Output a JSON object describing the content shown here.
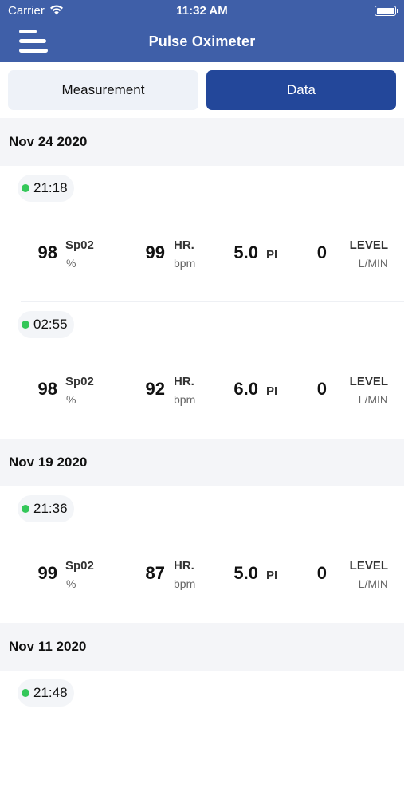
{
  "status_bar": {
    "carrier": "Carrier",
    "time": "11:32 AM"
  },
  "nav": {
    "title": "Pulse Oximeter"
  },
  "tabs": [
    {
      "label": "Measurement",
      "active": false
    },
    {
      "label": "Data",
      "active": true
    }
  ],
  "colors": {
    "header_bg": "#3f5fa8",
    "active_tab": "#23479a",
    "status_dot": "#34c759"
  },
  "groups": [
    {
      "date": "Nov 24 2020",
      "records": [
        {
          "time": "21:18",
          "spo2": "98",
          "spo2_label": "Sp02",
          "spo2_unit": "%",
          "hr": "99",
          "hr_label": "HR.",
          "hr_unit": "bpm",
          "pi": "5.0",
          "pi_label": "PI",
          "level": "0",
          "level_label": "LEVEL",
          "level_unit": "L/MIN"
        },
        {
          "time": "02:55",
          "spo2": "98",
          "spo2_label": "Sp02",
          "spo2_unit": "%",
          "hr": "92",
          "hr_label": "HR.",
          "hr_unit": "bpm",
          "pi": "6.0",
          "pi_label": "PI",
          "level": "0",
          "level_label": "LEVEL",
          "level_unit": "L/MIN"
        }
      ]
    },
    {
      "date": "Nov 19 2020",
      "records": [
        {
          "time": "21:36",
          "spo2": "99",
          "spo2_label": "Sp02",
          "spo2_unit": "%",
          "hr": "87",
          "hr_label": "HR.",
          "hr_unit": "bpm",
          "pi": "5.0",
          "pi_label": "PI",
          "level": "0",
          "level_label": "LEVEL",
          "level_unit": "L/MIN"
        }
      ]
    },
    {
      "date": "Nov 11 2020",
      "records": [
        {
          "time": "21:48",
          "spo2": "",
          "spo2_label": "",
          "spo2_unit": "",
          "hr": "",
          "hr_label": "",
          "hr_unit": "",
          "pi": "",
          "pi_label": "",
          "level": "",
          "level_label": "",
          "level_unit": ""
        }
      ]
    }
  ]
}
